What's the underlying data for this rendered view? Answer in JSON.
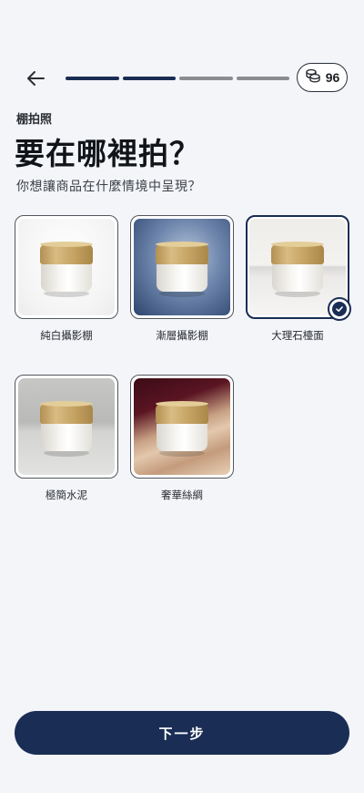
{
  "header": {
    "progress_steps": [
      true,
      true,
      false,
      false
    ],
    "credits": "96"
  },
  "eyebrow": "棚拍照",
  "title": "要在哪裡拍？",
  "subtitle": "你想讓商品在什麼情境中呈現？",
  "options": [
    {
      "label": "純白攝影棚",
      "selected": false
    },
    {
      "label": "漸層攝影棚",
      "selected": false
    },
    {
      "label": "大理石檯面",
      "selected": true
    },
    {
      "label": "極簡水泥",
      "selected": false
    },
    {
      "label": "奢華絲綢",
      "selected": false
    }
  ],
  "next_button": "下一步",
  "colors": {
    "accent": "#1a2d55",
    "background": "#f3f5f8"
  }
}
